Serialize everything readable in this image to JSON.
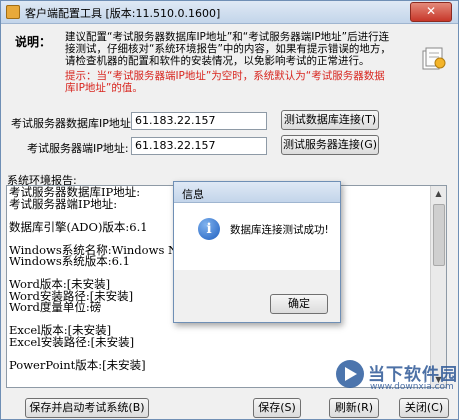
{
  "window": {
    "title": "客户端配置工具  [版本:11.510.0.1600]",
    "close_glyph": "✕"
  },
  "info": {
    "heading": "说明：",
    "text": "建议配置“考试服务器数据库IP地址”和“考试服务器端IP地址”后进行连接测试，仔细核对“系统环境报告”中的内容，如果有提示错误的地方，请检查机器的配置和软件的安装情况，以免影响考试的正常进行。",
    "hint": "提示：当“考试服务器端IP地址”为空时，系统默认为“考试服务器数据库IP地址”的值。"
  },
  "fields": {
    "db_ip_label": "考试服务器数据库IP地址:",
    "db_ip_value": "61.183.22.157",
    "server_ip_label": "考试服务器端IP地址:",
    "server_ip_value": "61.183.22.157"
  },
  "buttons": {
    "test_db": "测试数据库连接(T)",
    "test_server": "测试服务器连接(G)",
    "save_start": "保存并启动考试系统(B)",
    "save": "保存(S)",
    "refresh": "刷新(R)",
    "close": "关闭(C)"
  },
  "report": {
    "label": "系统环境报告:",
    "lines": [
      "考试服务器数据库IP地址:",
      "考试服务器端IP地址:",
      "",
      "数据库引擎(ADO)版本:6.1",
      "",
      "Windows系统名称:Windows NT",
      "Windows系统版本:6.1",
      "",
      "Word版本:[未安装]",
      "Word安装路径:[未安装]",
      "Word度量单位:磅",
      "",
      "Excel版本:[未安装]",
      "Excel安装路径:[未安装]",
      "",
      "PowerPoint版本:[未安装]"
    ]
  },
  "dialog": {
    "title": "信息",
    "icon": "info-icon",
    "message": "数据库连接测试成功!",
    "ok": "确定"
  },
  "watermark": {
    "brand": "当下软件园",
    "url": "www.downxia.com"
  }
}
